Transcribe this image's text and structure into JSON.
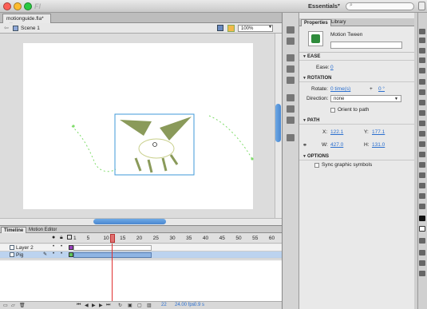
{
  "window": {
    "app_name": "Fl",
    "workspace": "Essentials",
    "workspace_arrow": "▾",
    "search_icon": "magnifier-icon"
  },
  "document": {
    "tab_label": "motionguide.fla*",
    "close_icon": "close-icon",
    "scene_label": "Scene 1",
    "zoom": "100%",
    "back_icon": "arrow-left-icon"
  },
  "timeline": {
    "tabs": [
      "Timeline",
      "Motion Editor"
    ],
    "frame_numbers": [
      "1",
      "5",
      "10",
      "15",
      "20",
      "25",
      "30",
      "35",
      "40",
      "45",
      "50",
      "55",
      "60"
    ],
    "current_frame_tick": 13,
    "layers": [
      {
        "name": "Layer 2"
      },
      {
        "name": "Pig"
      }
    ],
    "footer": {
      "frame": "22",
      "fps": "24.00 fps",
      "elapsed": "0.9 s"
    }
  },
  "properties": {
    "tabs": [
      "Properties",
      "Library"
    ],
    "instance_type": "Motion Tween",
    "sections": {
      "ease": "EASE",
      "rotation": "ROTATION",
      "path": "PATH",
      "options": "OPTIONS"
    },
    "ease_label": "Ease:",
    "ease_value": "0",
    "rotate_label": "Rotate:",
    "rotate_times": "0 time(s)",
    "rotate_plus": "+",
    "rotate_deg": "0 °",
    "direction_label": "Direction:",
    "direction_value": "none",
    "orient_label": "Orient to path",
    "x_label": "X:",
    "x_value": "122.1",
    "y_label": "Y:",
    "y_value": "177.1",
    "w_label": "W:",
    "w_value": "427.0",
    "h_label": "H:",
    "h_value": "131.0",
    "sync_label": "Sync graphic symbols"
  },
  "colors": {
    "selection": "#3f9ad8",
    "motion_path": "#7fdc6a",
    "graphic_fill": "#8a9a5a",
    "playhead": "#e03030"
  }
}
